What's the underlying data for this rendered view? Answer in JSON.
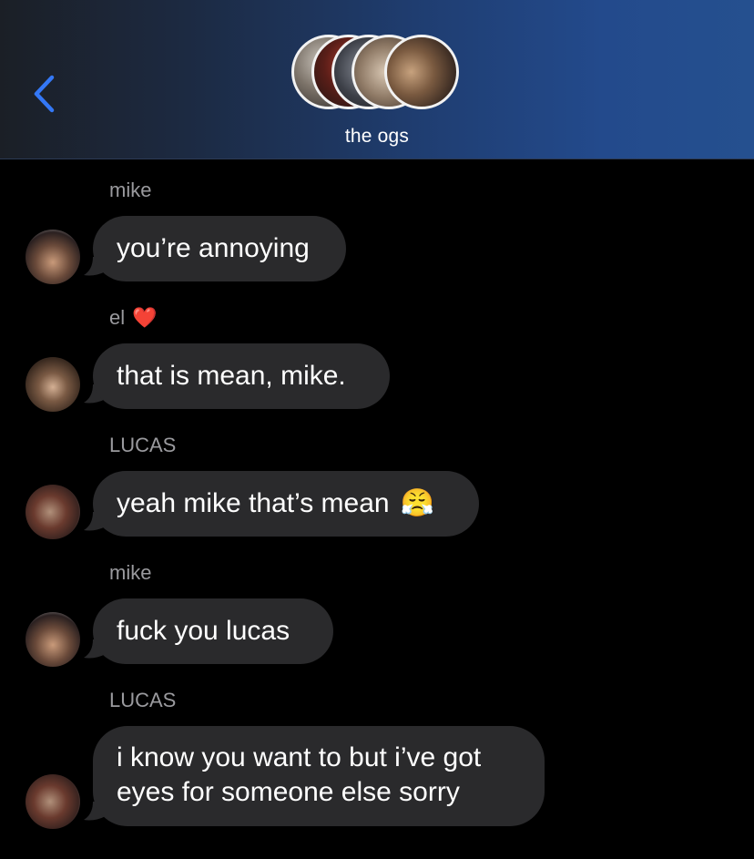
{
  "header": {
    "group_name": "the ogs",
    "back_icon": "chevron-left-icon",
    "accent_color": "#3478f6"
  },
  "messages": [
    {
      "sender": "mike",
      "text": "you’re annoying"
    },
    {
      "sender": "el",
      "sender_emoji": "❤️",
      "text": "that is mean, mike."
    },
    {
      "sender": "LUCAS",
      "text": "yeah mike that’s mean",
      "emoji": "😤"
    },
    {
      "sender": "mike",
      "text": "fuck you lucas"
    },
    {
      "sender": "LUCAS",
      "text_lines": [
        "i know you want to but i’ve got",
        "eyes for someone else sorry"
      ]
    }
  ],
  "colors": {
    "bubble": "#2a2a2c",
    "sender_name": "#9a9a9e",
    "background": "#000000"
  }
}
